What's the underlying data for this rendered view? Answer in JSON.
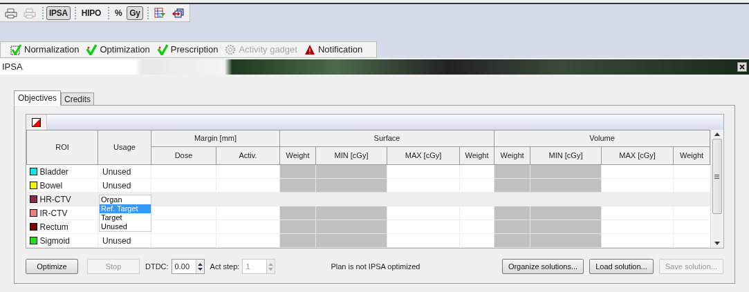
{
  "toolbar": [
    [
      {
        "kind": "print",
        "disabled": false,
        "pressed": false
      },
      {
        "kind": "print",
        "disabled": true,
        "pressed": false
      }
    ],
    [
      {
        "kind": "text",
        "label": "IPSA",
        "pressed": true
      }
    ],
    [
      {
        "kind": "text",
        "label": "HIPO",
        "pressed": false
      }
    ],
    [
      {
        "kind": "text",
        "label": "%",
        "pressed": false
      },
      {
        "kind": "text",
        "label": "Gy",
        "pressed": true
      }
    ],
    [
      {
        "kind": "grid",
        "pressed": false
      },
      {
        "kind": "cube",
        "pressed": false
      }
    ]
  ],
  "gadgets": [
    {
      "kind": "normalization",
      "label": "Normalization",
      "disabled": false
    },
    {
      "kind": "check",
      "label": "Optimization",
      "disabled": false
    },
    {
      "kind": "check",
      "label": "Prescription",
      "disabled": false
    },
    {
      "kind": "gear",
      "label": "Activity gadget",
      "disabled": true
    },
    {
      "kind": "warning",
      "label": "Notification",
      "disabled": false
    }
  ],
  "window": {
    "title": "IPSA"
  },
  "tabs": [
    {
      "label": "Objectives",
      "selected": true
    },
    {
      "label": "Credits",
      "selected": false
    }
  ],
  "table": {
    "columns": [
      {
        "label": "ROI"
      },
      {
        "label": "Usage"
      },
      {
        "label": "Margin [mm]",
        "children": [
          {
            "label": "Dose",
            "disabled": false
          },
          {
            "label": "Activ.",
            "disabled": false
          }
        ]
      },
      {
        "label": "Surface",
        "children": [
          {
            "label": "Weight",
            "disabled": true
          },
          {
            "label": "MIN [cGy]",
            "disabled": true
          },
          {
            "label": "MAX [cGy]",
            "disabled": false
          },
          {
            "label": "Weight",
            "disabled": false
          }
        ]
      },
      {
        "label": "Volume",
        "children": [
          {
            "label": "Weight",
            "disabled": true
          },
          {
            "label": "MIN [cGy]",
            "disabled": true
          },
          {
            "label": "MAX [cGy]",
            "disabled": false
          },
          {
            "label": "Weight",
            "disabled": false
          }
        ]
      }
    ],
    "rows": [
      {
        "roi": "Bladder",
        "color": "#1ee0ea",
        "usage": "Unused",
        "selected": false
      },
      {
        "roi": "Bowel",
        "color": "#f5f00a",
        "usage": "Unused",
        "selected": false
      },
      {
        "roi": "HR-CTV",
        "color": "#8a2c48",
        "selected": true,
        "usage_dropdown": [
          {
            "label": "Organ",
            "selected": false
          },
          {
            "label": "Ref. Target",
            "selected": true
          },
          {
            "label": "Target",
            "selected": false
          },
          {
            "label": "Unused",
            "selected": false
          }
        ]
      },
      {
        "roi": "IR-CTV",
        "color": "#f08080",
        "selected": false
      },
      {
        "roi": "Rectum",
        "color": "#7a0808",
        "selected": false
      },
      {
        "roi": "Sigmoid",
        "color": "#22dd22",
        "usage": "Unused",
        "selected": false
      }
    ]
  },
  "bottom": {
    "optimize": {
      "label": "Optimize",
      "disabled": false
    },
    "stop": {
      "label": "Stop",
      "disabled": true
    },
    "dtdc": {
      "label": "DTDC:",
      "value": "0.00",
      "disabled": false
    },
    "act_step": {
      "label": "Act step:",
      "value": "1",
      "disabled": true
    },
    "status": "Plan is not IPSA optimized",
    "buttons": [
      {
        "label": "Organize solutions...",
        "disabled": false
      },
      {
        "label": "Load solution...",
        "disabled": false
      },
      {
        "label": "Save solution...",
        "disabled": true
      }
    ]
  }
}
